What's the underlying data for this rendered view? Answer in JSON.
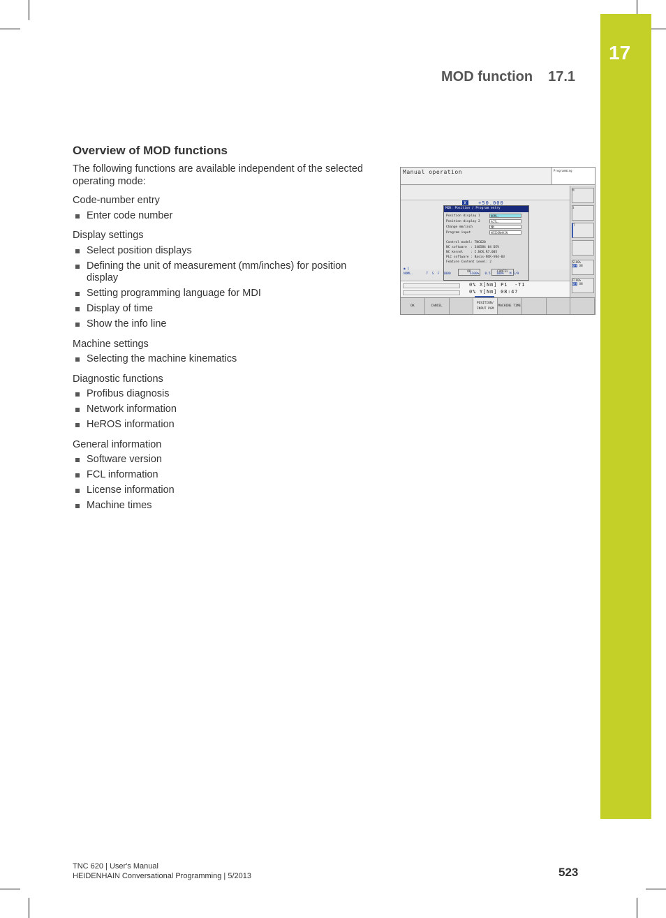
{
  "chapter_tab": {
    "number": "17",
    "color": "#c4cf27"
  },
  "running_head": {
    "title": "MOD function",
    "section": "17.1"
  },
  "section": {
    "heading": "Overview of MOD functions",
    "intro": "The following functions are available independent of the selected operating mode:",
    "groups": [
      {
        "label": "Code-number entry",
        "items": [
          "Enter code number"
        ]
      },
      {
        "label": "Display settings",
        "items": [
          "Select position displays",
          "Defining the unit of measurement (mm/inches) for position display",
          "Setting programming language for MDI",
          "Display of time",
          "Show the info line"
        ]
      },
      {
        "label": "Machine settings",
        "items": [
          "Selecting the machine kinematics"
        ]
      },
      {
        "label": "Diagnostic functions",
        "items": [
          "Profibus diagnosis",
          "Network information",
          "HeROS information"
        ]
      },
      {
        "label": "General information",
        "items": [
          "Software version",
          "FCL information",
          "License information",
          "Machine times"
        ]
      }
    ]
  },
  "screenshot": {
    "mode_title": "Manual operation",
    "programming_label": "Programming",
    "axis": "X",
    "axis_value": "+50.000",
    "dialog": {
      "title": "MOD: Position / Program entry",
      "rows": [
        {
          "label": "Position display 1",
          "value": "NOML."
        },
        {
          "label": "Position display 2",
          "value": "ACTL."
        },
        {
          "label": "Change mm/inch",
          "value": "MM"
        },
        {
          "label": "Program input",
          "value": "HEIDENHAIN"
        }
      ],
      "info": [
        "Control model: TNC620",
        "NC software  : 340584 04 DEV",
        "NC kernel    : C.NCK.R7.005",
        "PLC software : Basis-NCK-V04-03",
        "Feature Content Level: 2"
      ],
      "ok": "OK",
      "cancel": "CANCEL"
    },
    "status_indicator": "1",
    "status_line": "NOML.       T  S  F  1000          S100%   0.5   100%   M 5/9",
    "load_lines": [
      "0% X[Nm] P1  -T1",
      "0% Y[Nm] 08:47"
    ],
    "side_keys": [
      "M",
      "S",
      "T",
      "",
      "S100%",
      "F100%"
    ],
    "side_toggle": {
      "off": "OFF",
      "on": "ON"
    },
    "softkeys": [
      "OK",
      "CANCEL",
      "",
      "POSITION/ INPUT PGM",
      "MACHINE TIME",
      "",
      "",
      ""
    ]
  },
  "footer": {
    "line1": "TNC 620 | User's Manual",
    "line2": "HEIDENHAIN Conversational Programming | 5/2013",
    "page": "523"
  }
}
